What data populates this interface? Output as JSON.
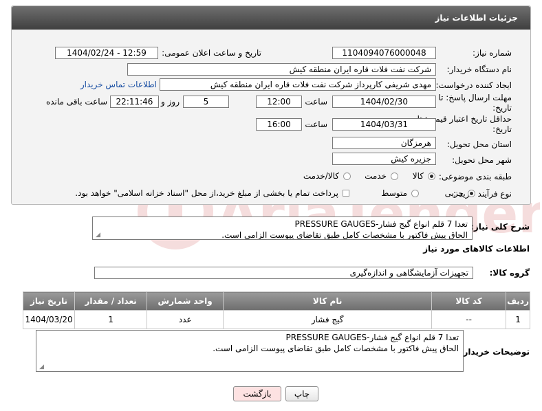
{
  "panel_title": "جزئیات اطلاعات نیاز",
  "fields": {
    "need_number": {
      "label": "شماره نیاز:",
      "value": "1104094076000048"
    },
    "announce": {
      "label": "تاریخ و ساعت اعلان عمومی:",
      "value": "1404/02/24 - 12:59"
    },
    "buyer": {
      "label": "نام دستگاه خریدار:",
      "value": "شرکت نفت فلات قاره ایران منطقه کیش"
    },
    "requester": {
      "label": "ایجاد کننده درخواست:",
      "value": "مهدی شریفی کارپرداز شرکت نفت فلات قاره ایران منطقه کیش",
      "contact_link": "اطلاعات تماس خریدار"
    },
    "deadline": {
      "label": "مهلت ارسال پاسخ: تا تاریخ:",
      "date": "1404/02/30",
      "time_label": "ساعت",
      "time": "12:00",
      "days": "5",
      "days_label": "روز و",
      "remaining": "22:11:46",
      "remaining_label": "ساعت باقی مانده"
    },
    "price_validity": {
      "label": "حداقل تاریخ اعتبار قیمت: تا تاریخ:",
      "date": "1404/03/31",
      "time_label": "ساعت",
      "time": "16:00"
    },
    "province": {
      "label": "استان محل تحویل:",
      "value": "هرمزگان"
    },
    "city": {
      "label": "شهر محل تحویل:",
      "value": "جزیره کیش"
    },
    "category": {
      "label": "طبقه بندی موضوعی:",
      "options": [
        "کالا",
        "خدمت",
        "کالا/خدمت"
      ],
      "selected": "کالا"
    },
    "process": {
      "label": "نوع فرآیند خرید :",
      "options": [
        "جزیی",
        "متوسط"
      ],
      "selected": "جزیی",
      "payment_note": "پرداخت تمام یا بخشی از مبلغ خرید،از محل \"اسناد خزانه اسلامی\" خواهد بود."
    }
  },
  "summary": {
    "label": "شرح کلی نیاز:",
    "line1": "تعدا 7 قلم انواع گیج فشار-PRESSURE GAUGES",
    "line2": "الحاق پیش فاکتور با مشخصات کامل طبق تقاضای پیوست الزامی است."
  },
  "goods_section_title": "اطلاعات کالاهای مورد نیاز",
  "goods_group": {
    "label": "گروه کالا:",
    "value": "تجهیزات آزمایشگاهی و اندازه‌گیری"
  },
  "table": {
    "headers": [
      "ردیف",
      "کد کالا",
      "نام کالا",
      "واحد شمارش",
      "تعداد / مقدار",
      "تاریخ نیاز"
    ],
    "rows": [
      [
        "1",
        "--",
        "گیج فشار",
        "عدد",
        "1",
        "1404/03/20"
      ]
    ]
  },
  "buyer_notes": {
    "label": "توضیحات خریدار:",
    "line1": "تعدا 7 قلم انواع گیج فشار-PRESSURE GAUGES",
    "line2": "الحاق پیش فاکتور با مشخصات کامل طبق تقاضای پیوست الزامی است."
  },
  "buttons": {
    "print": "چاپ",
    "back": "بازگشت"
  },
  "watermark": "AriaTender.neT",
  "colors": {
    "header_dark": "#3f3f3f",
    "link": "#1a4fa3",
    "back_button": "#fde2e2"
  }
}
